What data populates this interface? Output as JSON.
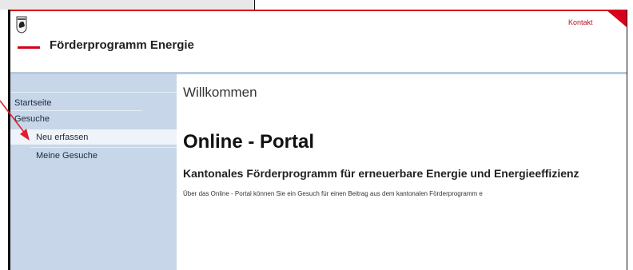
{
  "header": {
    "app_title": "Förderprogramm Energie",
    "contact_link": "Kontakt",
    "logo_icon": "coat-of-arms-bear-icon"
  },
  "sidebar": {
    "items": [
      {
        "label": "Startseite",
        "level": 1
      },
      {
        "label": "Gesuche",
        "level": 1
      },
      {
        "label": "Neu erfassen",
        "level": 2,
        "highlighted": true
      },
      {
        "label": "Meine Gesuche",
        "level": 2
      }
    ]
  },
  "main": {
    "welcome": "Willkommen",
    "title": "Online - Portal",
    "subtitle": "Kantonales Förderprogramm für erneuerbare Energie und Energieeffizienz",
    "intro": "Über das Online - Portal können Sie ein Gesuch für einen Beitrag aus dem kantonalen Förderprogramm e"
  },
  "annotation": {
    "arrow_icon": "red-arrow-icon",
    "color": "#e0202e"
  },
  "colors": {
    "brand_red": "#d6001c",
    "sidebar_bg": "#c7d7e9",
    "highlight_bg": "#eef4fa"
  }
}
